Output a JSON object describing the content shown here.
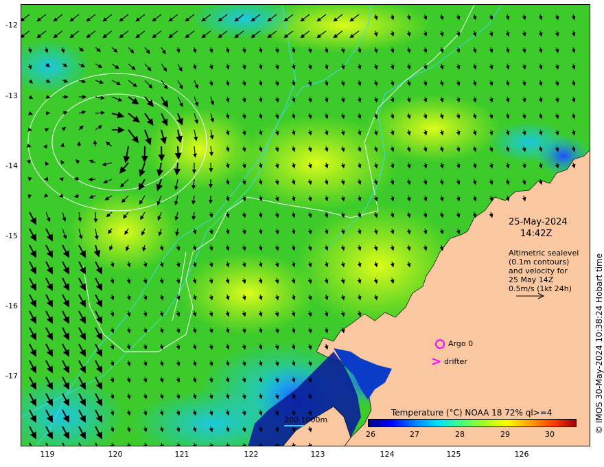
{
  "map": {
    "lat_ticks": [
      "-12",
      "-13",
      "-14",
      "-15",
      "-16",
      "-17"
    ],
    "lon_ticks": [
      "119",
      "120",
      "121",
      "122",
      "123",
      "124",
      "125",
      "126"
    ],
    "ocean_base_color": "#3ccb2a",
    "land_color": "#f9c7a0"
  },
  "annotation": {
    "date": "25-May-2024",
    "time": "14:42Z",
    "info_lines": [
      "Altimetric sealevel",
      "(0.1m contours)",
      "and velocity for",
      "25 May 14Z",
      "0.5m/s (1kt 24h)"
    ]
  },
  "markers": {
    "argo_label": "Argo 0",
    "drifter_label": "drifter",
    "marker_color": "#ff00ff"
  },
  "depth_legend": {
    "label": "200  1000m",
    "color": "#40c8e8"
  },
  "colorbar": {
    "title": "Temperature (°C) NOAA 18 72% ql>=4",
    "ticks": [
      "26",
      "27",
      "28",
      "29",
      "30"
    ],
    "colors": [
      "#00007f",
      "#0000ff",
      "#0080ff",
      "#00e0ff",
      "#40ff80",
      "#a0ff20",
      "#ffff00",
      "#ffa000",
      "#ff4000",
      "#a00000"
    ]
  },
  "copyright": "© IMOS 30-May-2024 10:38:24 Hobart time"
}
